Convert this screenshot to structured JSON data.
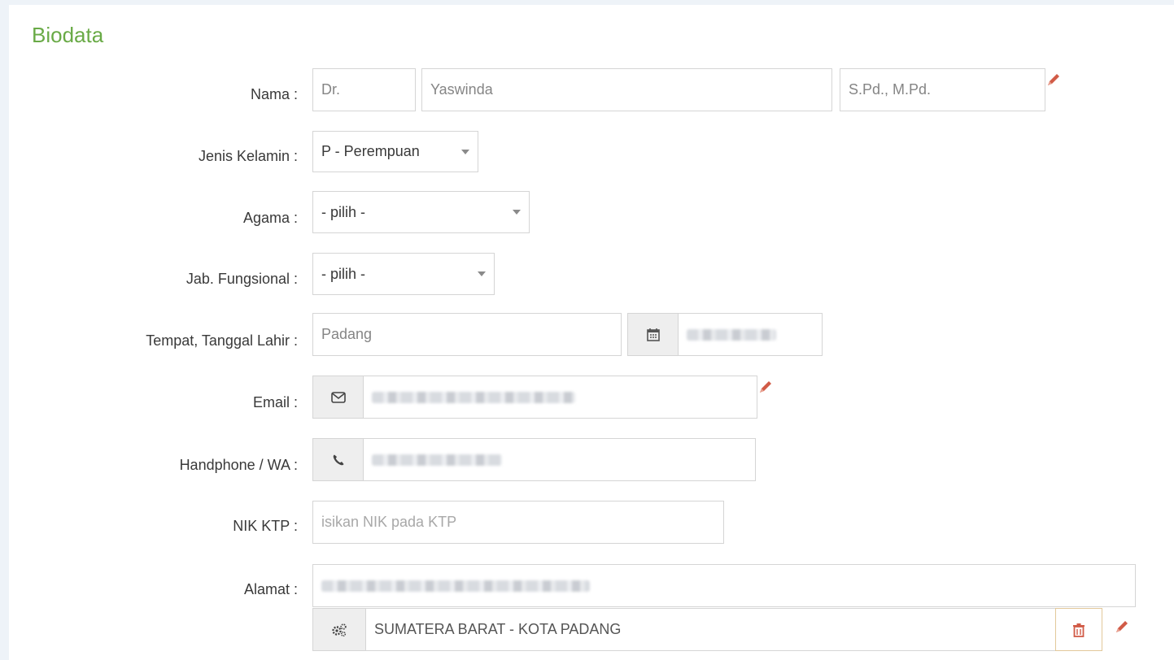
{
  "title": "Biodata",
  "labels": {
    "nama": "Nama :",
    "jenis_kelamin": "Jenis Kelamin :",
    "agama": "Agama :",
    "jab_fungsional": "Jab. Fungsional :",
    "ttl": "Tempat, Tanggal Lahir :",
    "email": "Email :",
    "handphone": "Handphone / WA :",
    "nik": "NIK KTP :",
    "alamat": "Alamat :"
  },
  "nama": {
    "gelar_depan": "Dr.",
    "nama": "Yaswinda",
    "gelar_belakang": "S.Pd., M.Pd."
  },
  "jenis_kelamin": {
    "selected": "P - Perempuan"
  },
  "agama": {
    "selected": "- pilih -"
  },
  "jab_fungsional": {
    "selected": "- pilih -"
  },
  "ttl": {
    "tempat": "Padang"
  },
  "nik": {
    "placeholder": "isikan NIK pada KTP"
  },
  "alamat": {
    "wilayah": "SUMATERA BARAT - KOTA PADANG"
  },
  "icons": {
    "edit": "pencil-icon",
    "calendar": "calendar-icon",
    "email": "envelope-icon",
    "phone": "phone-icon",
    "region": "gears-icon",
    "delete": "trash-icon"
  },
  "colors": {
    "title": "#69aa46",
    "edit_icon": "#d15b47",
    "delete_icon": "#d15b47"
  }
}
